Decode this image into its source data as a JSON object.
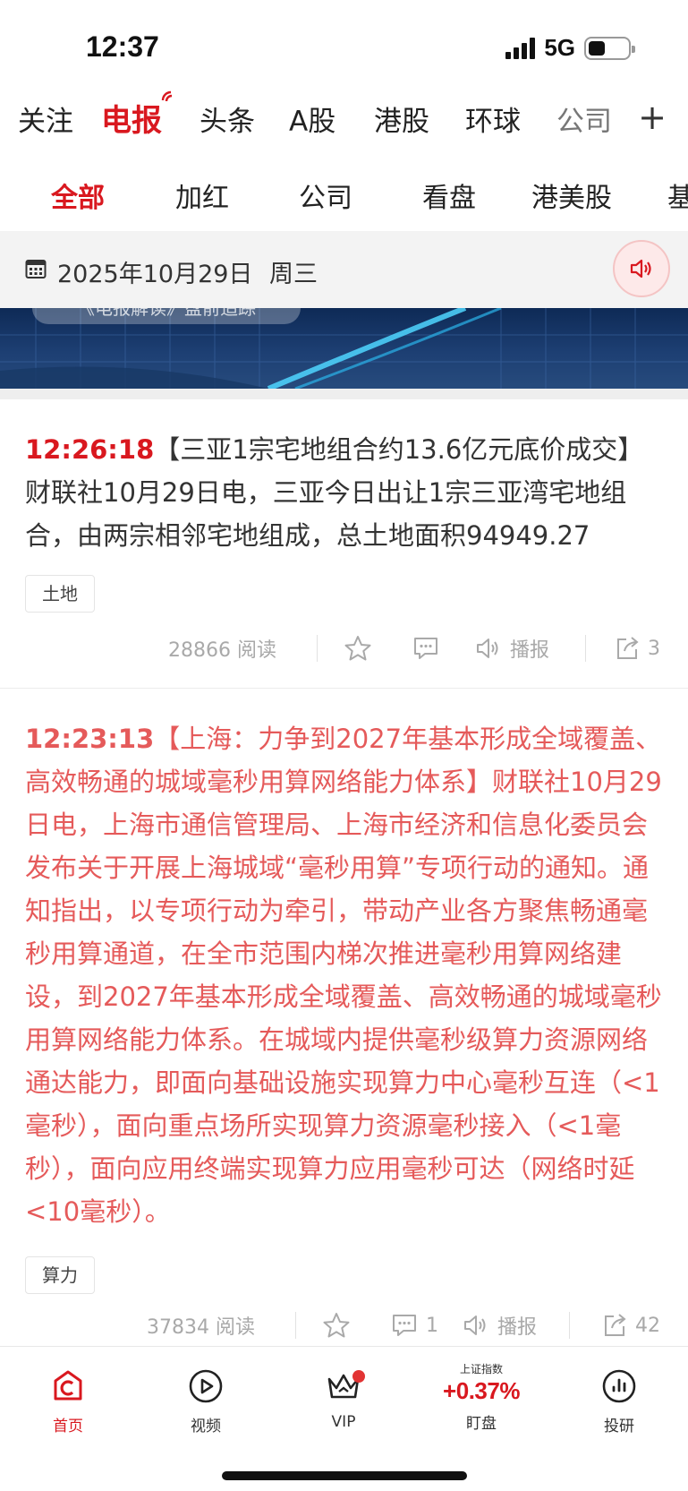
{
  "status_bar": {
    "time": "12:37",
    "network": "5G"
  },
  "top_nav": {
    "items": [
      {
        "label": "关注",
        "active": false
      },
      {
        "label": "电报",
        "active": true
      },
      {
        "label": "头条",
        "active": false
      },
      {
        "label": "A股",
        "active": false
      },
      {
        "label": "港股",
        "active": false
      },
      {
        "label": "环球",
        "active": false
      },
      {
        "label": "公司",
        "active": false
      }
    ],
    "plus_label": "+"
  },
  "sub_nav": {
    "items": [
      {
        "label": "全部",
        "active": true
      },
      {
        "label": "加红",
        "active": false
      },
      {
        "label": "公司",
        "active": false
      },
      {
        "label": "看盘",
        "active": false
      },
      {
        "label": "港美股",
        "active": false
      },
      {
        "label": "基",
        "active": false
      }
    ]
  },
  "date_bar": {
    "date": "2025年10月29日",
    "weekday": "周三"
  },
  "banner": {
    "pill_text": "《电报解读》盘前追踪"
  },
  "articles": [
    {
      "time": "12:26:18",
      "title": "【三亚1宗宅地组合约13.6亿元底价成交】",
      "body": "财联社10月29日电，三亚今日出让1宗三亚湾宅地组合，由两宗相邻宅地组成，总土地面积94949.27",
      "tag": "土地",
      "reads": "28866 阅读",
      "broadcast_label": "播报",
      "share_count": "3",
      "highlight": false
    },
    {
      "time": "12:23:13",
      "title": "【上海：力争到2027年基本形成全域覆盖、高效畅通的城域毫秒用算网络能力体系】",
      "body": "财联社10月29日电，上海市通信管理局、上海市经济和信息化委员会发布关于开展上海城域“毫秒用算”专项行动的通知。通知指出，以专项行动为牵引，带动产业各方聚焦畅通毫秒用算通道，在全市范围内梯次推进毫秒用算网络建设，到2027年基本形成全域覆盖、高效畅通的城域毫秒用算网络能力体系。在城域内提供毫秒级算力资源网络通达能力，即面向基础设施实现算力中心毫秒互连（<1毫秒），面向重点场所实现算力资源毫秒接入（<1毫秒），面向应用终端实现算力应用毫秒可达（网络时延<10毫秒）。",
      "tag": "算力",
      "reads": "37834 阅读",
      "comment_count": "1",
      "broadcast_label": "播报",
      "share_count": "42",
      "highlight": true
    }
  ],
  "tab_bar": {
    "items": [
      {
        "label": "首页",
        "icon": "home-c-icon",
        "active": true
      },
      {
        "label": "视频",
        "icon": "play-circle-icon",
        "active": false
      },
      {
        "label": "VIP",
        "icon": "crown-icon",
        "active": false
      },
      {
        "label": "盯盘",
        "icon": "index-quote",
        "active": false
      },
      {
        "label": "投研",
        "icon": "bar-chart-circle-icon",
        "active": false
      }
    ],
    "index_label": "上证指数",
    "index_value": "+0.37%"
  },
  "colors": {
    "brand_red": "#d9181f",
    "highlight_text": "#e55a5a",
    "muted": "#a9a9a9"
  }
}
